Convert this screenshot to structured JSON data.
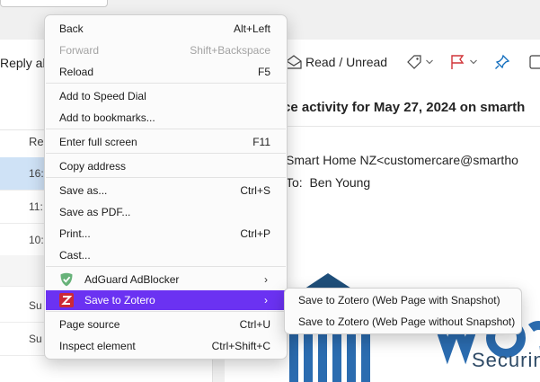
{
  "toolbar": {
    "reply_all": "Reply al",
    "read_unread": "Read / Unread"
  },
  "list": {
    "column_header": "Re",
    "rows": [
      {
        "time": "16:"
      },
      {
        "time": "11:"
      },
      {
        "time": "10:"
      },
      {
        "time": "Su"
      },
      {
        "time": "Su"
      }
    ]
  },
  "message": {
    "subject": "ce activity for May 27, 2024 on smarth",
    "from": "Smart Home NZ<customercare@smartho",
    "to_label": "To:",
    "to_name": "Ben Young",
    "logo_text": "Securin"
  },
  "context_menu": {
    "items": [
      {
        "label": "Back",
        "shortcut": "Alt+Left"
      },
      {
        "label": "Forward",
        "shortcut": "Shift+Backspace",
        "disabled": true
      },
      {
        "label": "Reload",
        "shortcut": "F5"
      },
      {
        "label": "Add to Speed Dial",
        "shortcut": ""
      },
      {
        "label": "Add to bookmarks...",
        "shortcut": ""
      },
      {
        "label": "Enter full screen",
        "shortcut": "F11"
      },
      {
        "label": "Copy address",
        "shortcut": ""
      },
      {
        "label": "Save as...",
        "shortcut": "Ctrl+S"
      },
      {
        "label": "Save as PDF...",
        "shortcut": ""
      },
      {
        "label": "Print...",
        "shortcut": "Ctrl+P"
      },
      {
        "label": "Cast...",
        "shortcut": ""
      },
      {
        "label": "AdGuard AdBlocker",
        "shortcut": "",
        "icon": "adguard-shield-icon",
        "submenu": true
      },
      {
        "label": "Save to Zotero",
        "shortcut": "",
        "icon": "zotero-z-icon",
        "submenu": true,
        "highlighted": true
      },
      {
        "label": "Page source",
        "shortcut": "Ctrl+U"
      },
      {
        "label": "Inspect element",
        "shortcut": "Ctrl+Shift+C"
      }
    ],
    "highlight_color": "#6b32f2"
  },
  "zotero_submenu": {
    "items": [
      {
        "label": "Save to Zotero (Web Page with Snapshot)"
      },
      {
        "label": "Save to Zotero (Web Page without Snapshot)"
      }
    ]
  },
  "colors": {
    "selected_row": "#cfe2f6",
    "adguard_green": "#67b279",
    "zotero_red": "#cc2936",
    "flag_red": "#d13438",
    "pin_blue": "#0f6cbd"
  }
}
